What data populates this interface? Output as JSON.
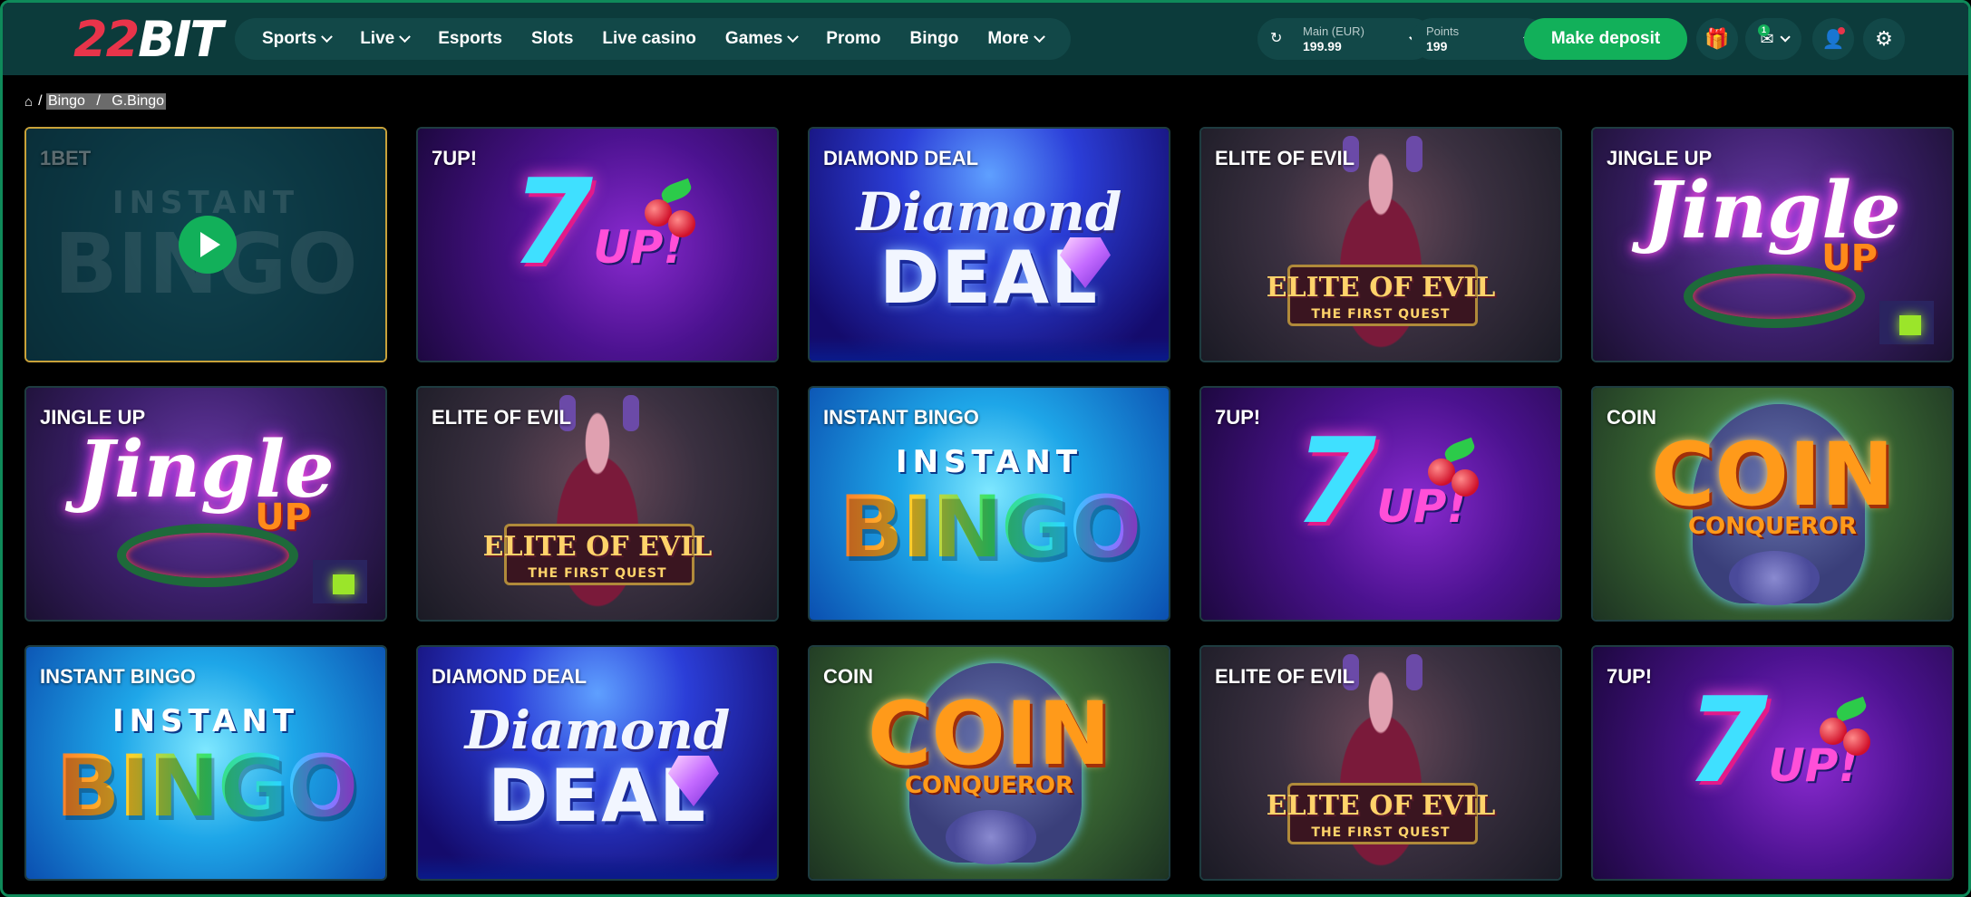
{
  "header": {
    "logo_num": "22",
    "logo_text": "BIT",
    "nav": [
      {
        "label": "Sports",
        "dropdown": true
      },
      {
        "label": "Live",
        "dropdown": true
      },
      {
        "label": "Esports",
        "dropdown": false
      },
      {
        "label": "Slots",
        "dropdown": false
      },
      {
        "label": "Live casino",
        "dropdown": false
      },
      {
        "label": "Games",
        "dropdown": true
      },
      {
        "label": "Promo",
        "dropdown": false
      },
      {
        "label": "Bingo",
        "dropdown": false
      },
      {
        "label": "More",
        "dropdown": true
      }
    ],
    "balance": {
      "label": "Main (EUR)",
      "value": "199.99"
    },
    "points": {
      "label": "Points",
      "value": "199"
    },
    "deposit_label": "Make deposit",
    "mail_badge": "1"
  },
  "breadcrumb": {
    "items": [
      "Bingo",
      "G.Bingo"
    ],
    "separator": "/"
  },
  "games": [
    {
      "title": "1BET",
      "theme": "1bet"
    },
    {
      "title": "7UP!",
      "theme": "sevenup"
    },
    {
      "title": "DIAMOND DEAL",
      "theme": "diamond"
    },
    {
      "title": "ELITE OF EVIL",
      "theme": "elite"
    },
    {
      "title": "JINGLE UP",
      "theme": "jingle"
    },
    {
      "title": "JINGLE UP",
      "theme": "jingle"
    },
    {
      "title": "ELITE OF EVIL",
      "theme": "elite"
    },
    {
      "title": "INSTANT BINGO",
      "theme": "instant"
    },
    {
      "title": "7UP!",
      "theme": "sevenup"
    },
    {
      "title": "COIN",
      "theme": "coin"
    },
    {
      "title": "INSTANT BINGO",
      "theme": "instant"
    },
    {
      "title": "DIAMOND DEAL",
      "theme": "diamond"
    },
    {
      "title": "COIN",
      "theme": "coin"
    },
    {
      "title": "ELITE OF EVIL",
      "theme": "elite"
    },
    {
      "title": "7UP!",
      "theme": "sevenup"
    }
  ],
  "art_text": {
    "sevenup": {
      "big": "7",
      "small": "UP!"
    },
    "diamond": {
      "line1": "Diamond",
      "line2": "DEAL"
    },
    "elite": {
      "line1": "ELITE OF EVIL",
      "line2": "THE FIRST QUEST"
    },
    "jingle": {
      "line1": "Jingle",
      "line2": "UP"
    },
    "instant": {
      "line1": "INSTANT",
      "line2": "BINGO"
    },
    "coin": {
      "line1": "COIN",
      "line2": "CONQUEROR"
    }
  },
  "colors": {
    "header_bg": "#0c3b3b",
    "accent_green": "#12b05a",
    "brand_red": "#e8344a"
  }
}
